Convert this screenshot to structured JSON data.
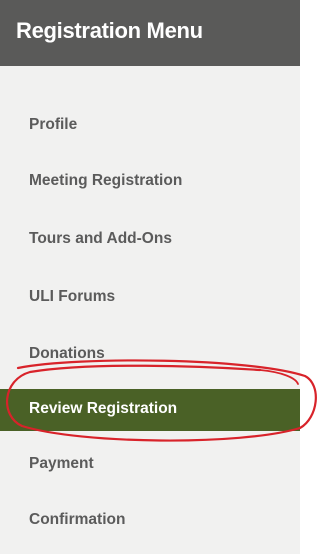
{
  "header": {
    "title": "Registration Menu"
  },
  "menu": {
    "items": [
      {
        "label": "Profile",
        "active": false
      },
      {
        "label": "Meeting Registration",
        "active": false
      },
      {
        "label": "Tours and Add-Ons",
        "active": false
      },
      {
        "label": "ULI Forums",
        "active": false
      },
      {
        "label": "Donations",
        "active": false
      },
      {
        "label": "Review Registration",
        "active": true
      },
      {
        "label": "Payment",
        "active": false
      },
      {
        "label": "Confirmation",
        "active": false
      }
    ]
  },
  "colors": {
    "header_bg": "#5a5a59",
    "panel_bg": "#f1f1f0",
    "active_bg": "#4a6126",
    "annotation": "#d8232a"
  }
}
